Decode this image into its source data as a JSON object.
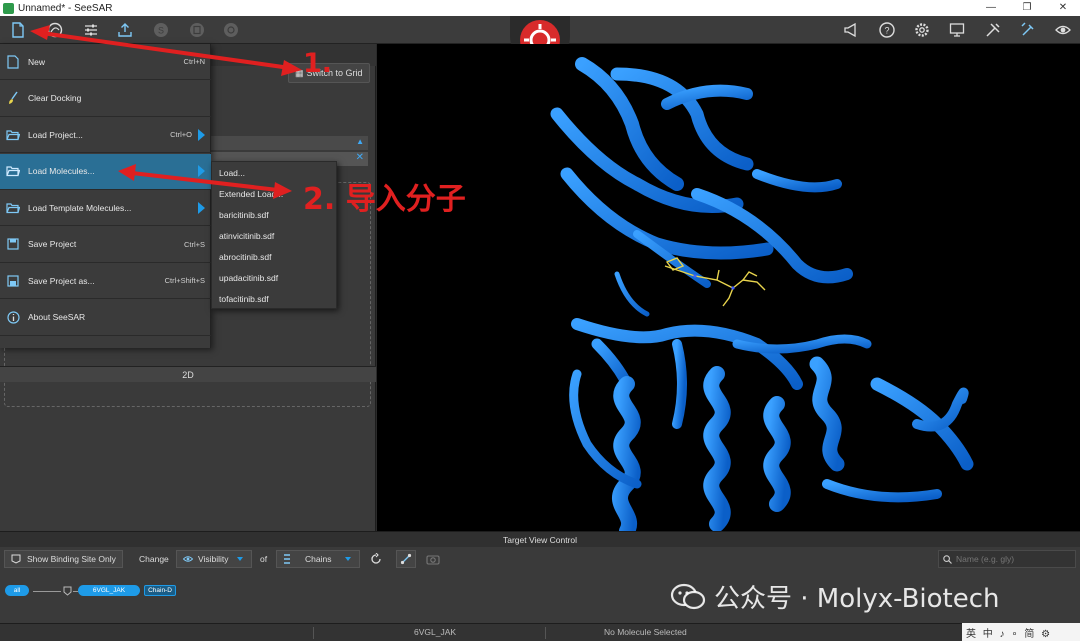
{
  "window": {
    "title": "Unnamed* - SeeSAR",
    "minimize": "—",
    "restore": "❐",
    "close": "✕"
  },
  "left_panel": {
    "switch_label": "Switch to Grid",
    "panel_label": "2D"
  },
  "file_menu": {
    "items": [
      {
        "label": "New",
        "shortcut": "Ctrl+N",
        "icon": "new-file-icon"
      },
      {
        "label": "Clear Docking",
        "shortcut": "",
        "icon": "brush-icon"
      },
      {
        "label": "Load Project...",
        "shortcut": "Ctrl+O",
        "icon": "folder-open-icon",
        "submenu": true
      },
      {
        "label": "Load Molecules...",
        "shortcut": "",
        "icon": "folder-open-icon",
        "submenu": true,
        "active": true
      },
      {
        "label": "Load Template Molecules...",
        "shortcut": "",
        "icon": "folder-open-icon",
        "submenu": true
      },
      {
        "label": "Save Project",
        "shortcut": "Ctrl+S",
        "icon": "save-icon"
      },
      {
        "label": "Save Project as...",
        "shortcut": "Ctrl+Shift+S",
        "icon": "save-as-icon"
      },
      {
        "label": "About SeeSAR",
        "shortcut": "",
        "icon": "info-icon"
      }
    ]
  },
  "submenu": {
    "items": [
      "Load...",
      "Extended Load...",
      "baricitinib.sdf",
      "atinvicitinib.sdf",
      "abrocitinib.sdf",
      "upadacitinib.sdf",
      "tofacitinib.sdf"
    ]
  },
  "annotations": {
    "step1": "1.",
    "step2": "2. 导入分子"
  },
  "target_view": {
    "header": "Target View Control",
    "show_binding_site": "Show Binding Site Only",
    "change": "Change",
    "visibility": "Visibility",
    "of": "of",
    "chains": "Chains",
    "search_placeholder": "Name (e.g. gly)",
    "tree": {
      "all": "all",
      "structure": "6VGL_JAK",
      "chain": "Chain-D"
    }
  },
  "status_bar": {
    "structure": "6VGL_JAK",
    "molecule": "No Molecule Selected"
  },
  "watermark": {
    "text": "公众号 · Molyx-Biotech"
  },
  "ime": {
    "text": "英 中 ♪ ∘ 简 ⚙"
  },
  "colors": {
    "accent": "#1e9be8",
    "active_menu": "#2a6f95",
    "protein": "#1e90ff",
    "ligand": "#e8d44d",
    "annotation": "#e02020",
    "logo": "#d82b2b"
  }
}
